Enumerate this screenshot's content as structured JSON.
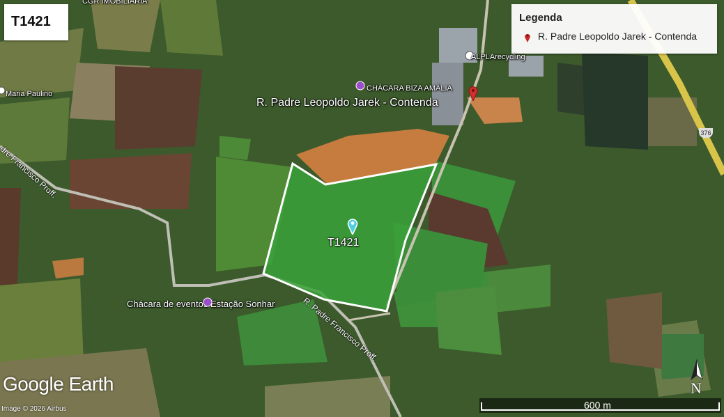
{
  "title_box": {
    "text": "T1421"
  },
  "legend": {
    "title": "Legenda",
    "item_label": "R. Padre Leopoldo Jarek - Contenda",
    "item_color": "#c62828"
  },
  "map_labels": {
    "polygon_label": "T1421",
    "marker_label": "R. Padre Leopoldo Jarek - Contenda",
    "chacara_biza": "CHÁCARA BIZA AMÁLIA",
    "alpla": "ALPLArecycling",
    "cgr": "CGR IMOBILIÁRIA",
    "maria_paulino": "Maria Paulino",
    "chacara_eventos": "Chácara de eventos Estação Sonhar",
    "road_padre_francisco": "R. Padre Francisco Proff.",
    "road_francisco_prof": "R. Padre Francisco Proff.",
    "road_left": "dre Francisco Proff."
  },
  "highway_shield": "376",
  "branding": {
    "logo": "Google Earth",
    "copyright": "Image © 2026 Airbus"
  },
  "scale": {
    "label": "600 m"
  },
  "compass": {
    "label": "N"
  },
  "colors": {
    "polygon_fill": "#3aa23a",
    "polygon_stroke": "#ffffff",
    "marker_red": "#d32f2f",
    "marker_cyan": "#4dd0e1"
  }
}
